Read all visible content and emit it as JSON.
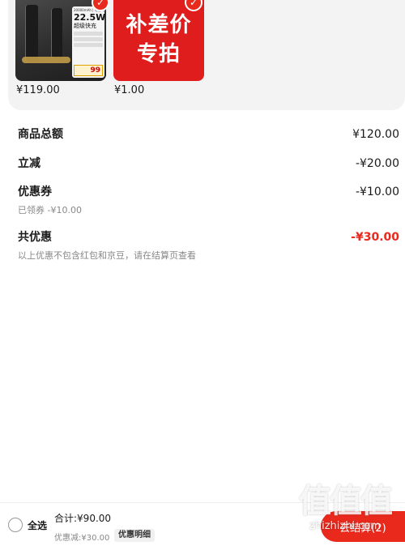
{
  "products": [
    {
      "price": "¥119.00",
      "spec": {
        "capacity_line": "20000mAh | 可上飞机",
        "power": "22.5W",
        "fast_charge": "超级快充",
        "promo": "99"
      }
    },
    {
      "price": "¥1.00",
      "promo_line1": "补差价",
      "promo_line2": "专拍"
    }
  ],
  "summary": {
    "total_label": "商品总额",
    "total_value": "¥120.00",
    "instant_label": "立减",
    "instant_value": "-¥20.00",
    "coupon_label": "优惠券",
    "coupon_value": "-¥10.00",
    "coupon_note": "已领券 -¥10.00",
    "discount_label": "共优惠",
    "discount_value": "-¥30.00",
    "discount_note": "以上优惠不包含红包和京豆，请在结算页查看"
  },
  "bottom_bar": {
    "select_all": "全选",
    "total": "合计:¥90.00",
    "discount_small": "优惠减:¥30.00",
    "detail_button": "优惠明细",
    "checkout_button": "去结算(2)"
  },
  "watermark": {
    "big": "值值值",
    "small": "zhizhizhi.com"
  },
  "colors": {
    "accent": "#e8291c",
    "card_bg": "#f3f3f3"
  }
}
